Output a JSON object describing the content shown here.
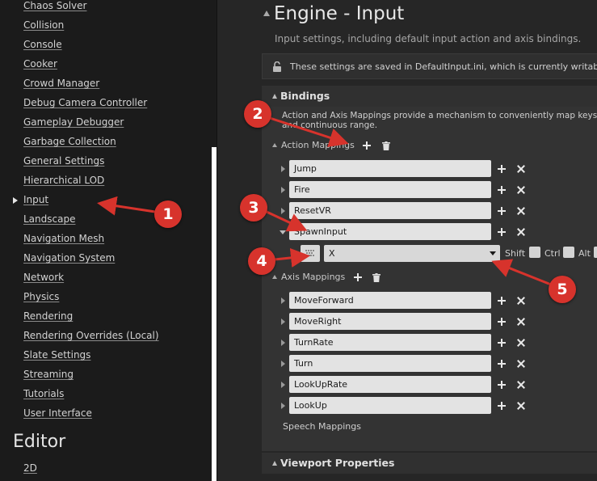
{
  "sidebar": {
    "items": [
      {
        "label": "Chaos Solver"
      },
      {
        "label": "Collision"
      },
      {
        "label": "Console"
      },
      {
        "label": "Cooker"
      },
      {
        "label": "Crowd Manager"
      },
      {
        "label": "Debug Camera Controller"
      },
      {
        "label": "Gameplay Debugger"
      },
      {
        "label": "Garbage Collection"
      },
      {
        "label": "General Settings"
      },
      {
        "label": "Hierarchical LOD"
      },
      {
        "label": "Input",
        "selected": true
      },
      {
        "label": "Landscape"
      },
      {
        "label": "Navigation Mesh"
      },
      {
        "label": "Navigation System"
      },
      {
        "label": "Network"
      },
      {
        "label": "Physics"
      },
      {
        "label": "Rendering"
      },
      {
        "label": "Rendering Overrides (Local)"
      },
      {
        "label": "Slate Settings"
      },
      {
        "label": "Streaming"
      },
      {
        "label": "Tutorials"
      },
      {
        "label": "User Interface"
      }
    ],
    "section_title": "Editor",
    "section_items": [
      {
        "label": "2D"
      }
    ]
  },
  "main": {
    "title": "Engine - Input",
    "description": "Input settings, including default input action and axis bindings.",
    "notice": "These settings are saved in DefaultInput.ini, which is currently writable.",
    "bindings": {
      "title": "Bindings",
      "description": "Action and Axis Mappings provide a mechanism to conveniently map keys and continuous range.",
      "action_mappings": {
        "label": "Action Mappings",
        "items": [
          {
            "name": "Jump"
          },
          {
            "name": "Fire"
          },
          {
            "name": "ResetVR"
          },
          {
            "name": "SpawnInput",
            "expanded": true
          }
        ],
        "key_row": {
          "key": "X",
          "modifiers": [
            {
              "label": "Shift",
              "checked": false
            },
            {
              "label": "Ctrl",
              "checked": false
            },
            {
              "label": "Alt",
              "checked": false
            }
          ]
        }
      },
      "axis_mappings": {
        "label": "Axis Mappings",
        "items": [
          {
            "name": "MoveForward"
          },
          {
            "name": "MoveRight"
          },
          {
            "name": "TurnRate"
          },
          {
            "name": "Turn"
          },
          {
            "name": "LookUpRate"
          },
          {
            "name": "LookUp"
          }
        ]
      },
      "speech_mappings": {
        "label": "Speech Mappings"
      }
    },
    "viewport_properties": {
      "title": "Viewport Properties"
    }
  },
  "annotations": [
    {
      "number": "1"
    },
    {
      "number": "2"
    },
    {
      "number": "3"
    },
    {
      "number": "4"
    },
    {
      "number": "5"
    }
  ],
  "colors": {
    "annotation": "#d7332c",
    "field_bg": "#e3e3e3",
    "panel_bg": "#333333",
    "sidebar_bg": "#1b1b1b"
  },
  "icons": {
    "notice": "lock-icon",
    "add": "plus-icon",
    "remove": "x-icon",
    "clear": "trash-icon",
    "key_picker": "keyboard-icon",
    "dropdown": "chevron-down-icon"
  }
}
